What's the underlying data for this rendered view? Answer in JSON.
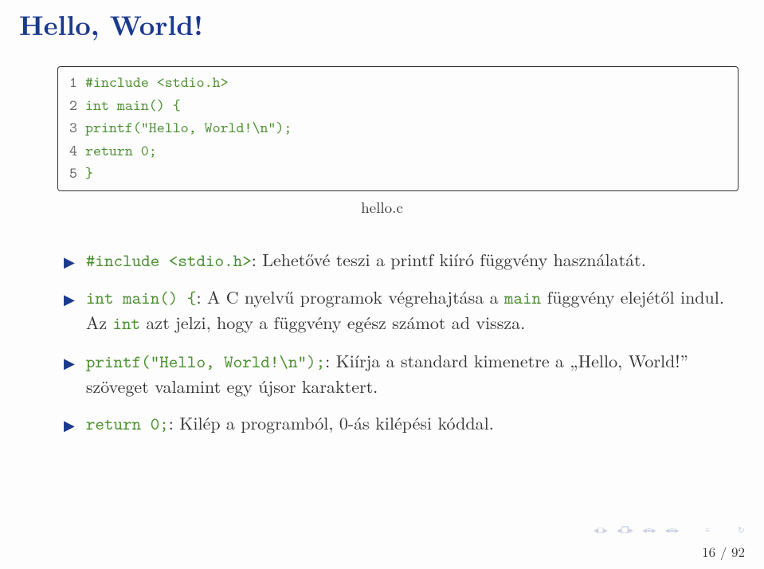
{
  "title": "Hello, World!",
  "code": {
    "lines": [
      "1",
      "2",
      "3",
      "4",
      "5"
    ],
    "l1": "#include <stdio.h>",
    "l2": "int main() {",
    "l3_indent": "    ",
    "l3": "printf(\"Hello, World!\\n\");",
    "l4_indent": "    ",
    "l4": "return 0;",
    "l5": "}",
    "caption": "hello.c"
  },
  "bullets": {
    "b1_code": "#include <stdio.h>",
    "b1_text": ": Lehetővé teszi a printf kiíró függvény használatát.",
    "b2_code": "int main() {",
    "b2_text_a": ": A C nyelvű programok végrehajtása a ",
    "b2_tt_a": "main",
    "b2_text_b": " függvény elejétől indul. Az ",
    "b2_tt_b": "int",
    "b2_text_c": " azt jelzi, hogy a függvény egész számot ad vissza.",
    "b3_code": "printf(\"Hello, World!\\n\");",
    "b3_text": ": Kiírja a standard kimenetre a „Hello, World!” szöveget valamint egy újsor karaktert.",
    "b4_code": "return 0;",
    "b4_text": ": Kilép a programból, 0-ás kilépési kóddal."
  },
  "page": "16 / 92"
}
